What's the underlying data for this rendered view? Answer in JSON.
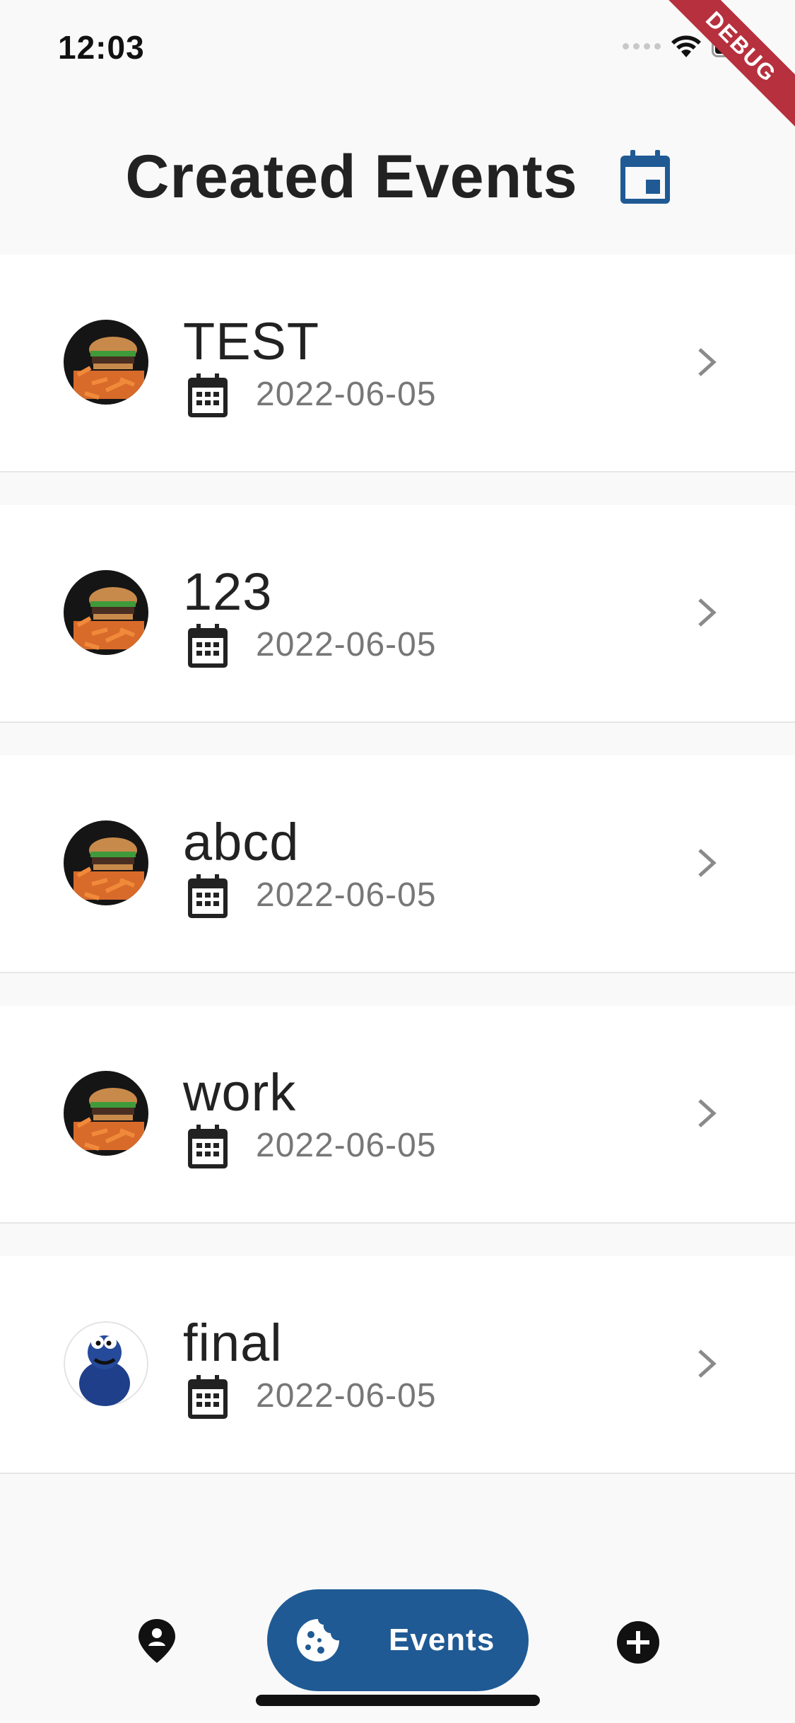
{
  "status_bar": {
    "time": "12:03"
  },
  "debug_banner": "DEBUG",
  "header": {
    "title": "Created Events"
  },
  "events": [
    {
      "title": "TEST",
      "date": "2022-06-05",
      "image": "burger"
    },
    {
      "title": "123",
      "date": "2022-06-05",
      "image": "burger"
    },
    {
      "title": "abcd",
      "date": "2022-06-05",
      "image": "burger"
    },
    {
      "title": "work",
      "date": "2022-06-05",
      "image": "burger"
    },
    {
      "title": "final",
      "date": "2022-06-05",
      "image": "cookie-monster"
    }
  ],
  "bottom_nav": {
    "items": [
      {
        "icon": "location-person-icon",
        "label": ""
      },
      {
        "icon": "cookie-icon",
        "label": "Events",
        "active": true
      },
      {
        "icon": "add-circle-icon",
        "label": ""
      }
    ]
  },
  "colors": {
    "accent": "#1f5a94",
    "debug": "#b7303d",
    "background": "#f9f9f9",
    "date_text": "#777777"
  }
}
